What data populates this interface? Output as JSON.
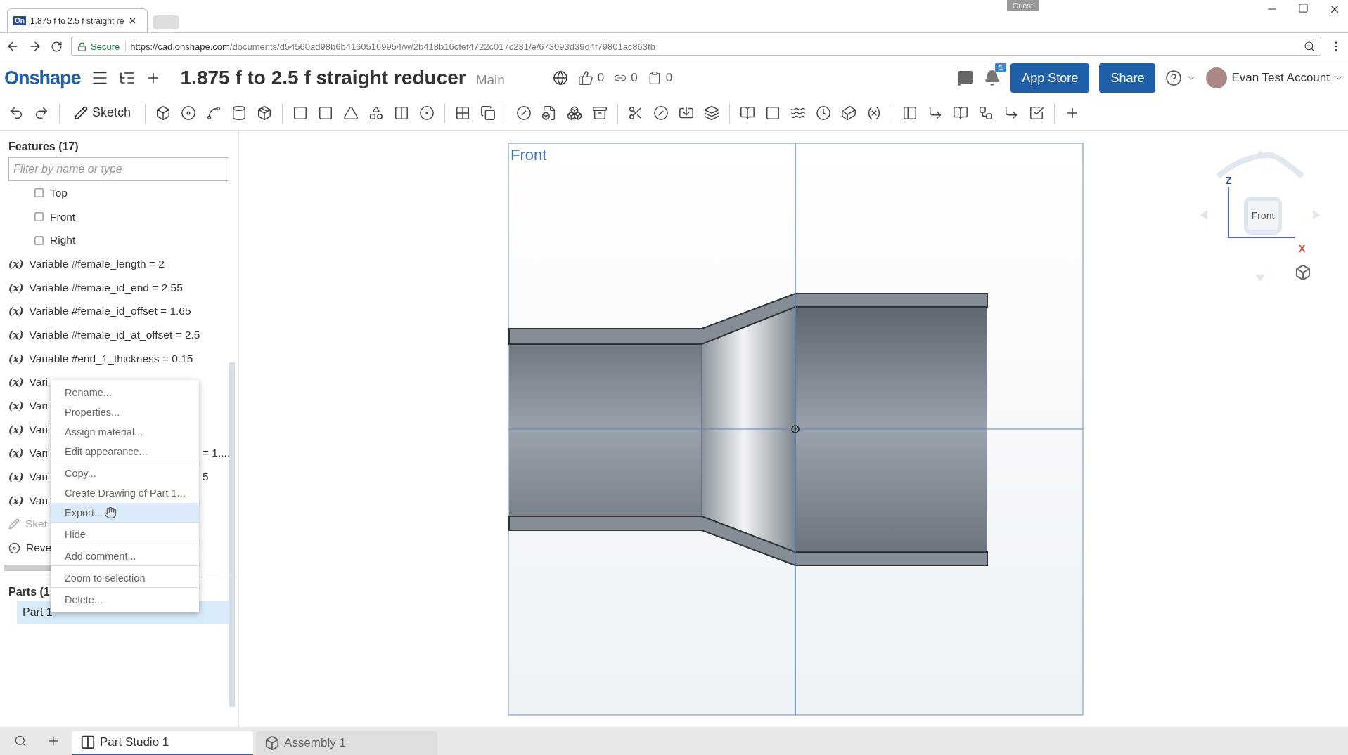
{
  "browser": {
    "tab_title": "1.875 f to 2.5 f straight re",
    "tab_icon": "On",
    "guest": "Guest",
    "secure": "Secure",
    "url_host": "https://cad.onshape.com",
    "url_path": "/documents/d54560ad98b6b41605169954/w/2b418b16cfef4722c017c231/e/673093d39d4f79801ac863fb"
  },
  "header": {
    "logo": "Onshape",
    "title": "1.875 f to 2.5 f straight reducer",
    "branch": "Main",
    "likes": "0",
    "links": "0",
    "copies": "0",
    "notifications": "1",
    "app_store": "App Store",
    "share": "Share",
    "user": "Evan Test Account"
  },
  "toolbar": {
    "sketch": "Sketch"
  },
  "features": {
    "title": "Features (17)",
    "filter_placeholder": "Filter by name or type",
    "items": [
      {
        "kind": "plane",
        "label": "Top"
      },
      {
        "kind": "plane",
        "label": "Front"
      },
      {
        "kind": "plane",
        "label": "Right"
      },
      {
        "kind": "variable",
        "symbol": "(x)",
        "label": "Variable #female_length = 2"
      },
      {
        "kind": "variable",
        "symbol": "(x)",
        "label": "Variable #female_id_end = 2.55"
      },
      {
        "kind": "variable",
        "symbol": "(x)",
        "label": "Variable #female_id_offset = 1.65"
      },
      {
        "kind": "variable",
        "symbol": "(x)",
        "label": "Variable #female_id_at_offset = 2.5"
      },
      {
        "kind": "variable",
        "symbol": "(x)",
        "label": "Variable #end_1_thickness = 0.15"
      },
      {
        "kind": "variable",
        "symbol": "(x)",
        "label": "Vari"
      },
      {
        "kind": "variable",
        "symbol": "(x)",
        "label": "Vari"
      },
      {
        "kind": "variable",
        "symbol": "(x)",
        "label": "Vari"
      },
      {
        "kind": "variable",
        "symbol": "(x)",
        "label": "Vari",
        "tail": "= 1...."
      },
      {
        "kind": "variable",
        "symbol": "(x)",
        "label": "Vari",
        "tail": "5"
      },
      {
        "kind": "variable",
        "symbol": "(x)",
        "label": "Vari"
      },
      {
        "kind": "sketch",
        "label": "Sket"
      },
      {
        "kind": "revolve",
        "label": "Reve"
      }
    ]
  },
  "parts": {
    "title": "Parts (1",
    "items": [
      {
        "label": "Part 1",
        "selected": true
      }
    ]
  },
  "context_menu": [
    {
      "label": "Rename...",
      "selected": false,
      "divider": false
    },
    {
      "label": "Properties...",
      "selected": false,
      "divider": false
    },
    {
      "label": "Assign material...",
      "selected": false,
      "divider": false
    },
    {
      "label": "Edit appearance...",
      "selected": false,
      "divider": true
    },
    {
      "label": "Copy...",
      "selected": false,
      "divider": false
    },
    {
      "label": "Create Drawing of Part 1...",
      "selected": false,
      "divider": false
    },
    {
      "label": "Export...",
      "selected": true,
      "divider": true
    },
    {
      "label": "Hide",
      "selected": false,
      "divider": true
    },
    {
      "label": "Add comment...",
      "selected": false,
      "divider": true
    },
    {
      "label": "Zoom to selection",
      "selected": false,
      "divider": true
    },
    {
      "label": "Delete...",
      "selected": false,
      "divider": false
    }
  ],
  "viewport": {
    "view_label": "Front",
    "cube_face": "Front",
    "axis_z": "Z",
    "axis_x": "X"
  },
  "bottom_tabs": [
    {
      "label": "Part Studio 1",
      "selected": true
    },
    {
      "label": "Assembly 1",
      "selected": false
    }
  ]
}
